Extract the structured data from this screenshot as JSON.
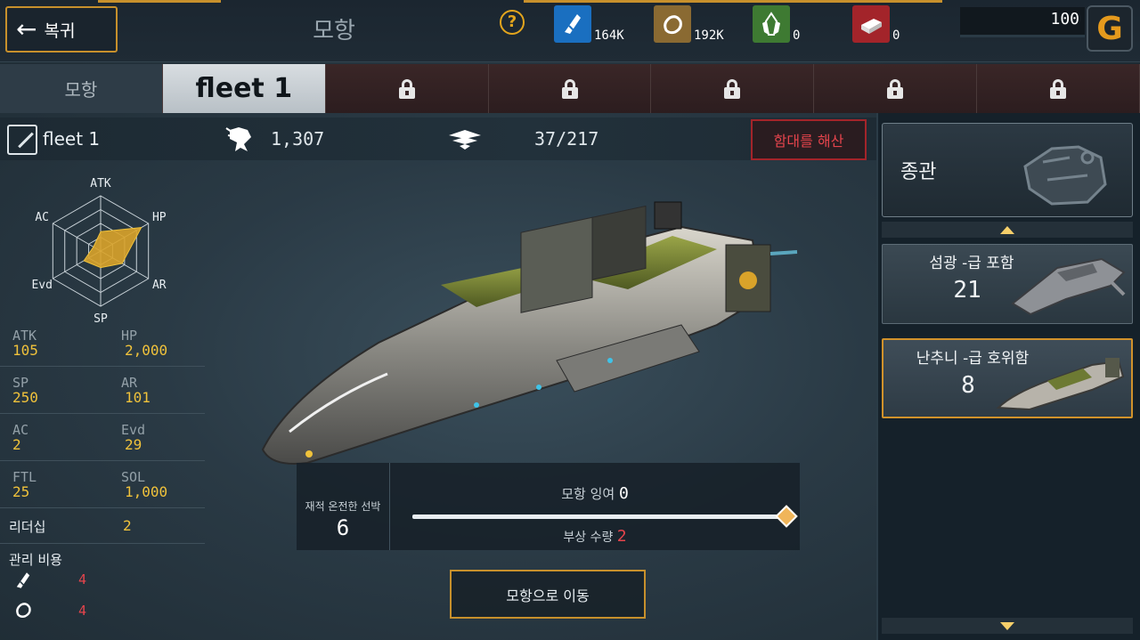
{
  "header": {
    "back_label": "복귀",
    "title": "모항",
    "help_symbol": "?",
    "resources": [
      {
        "icon": "lightning-resource-icon",
        "value": "164K",
        "color": "#1a6fc0"
      },
      {
        "icon": "ore-resource-icon",
        "value": "192K",
        "color": "#8a6a32"
      },
      {
        "icon": "crystal-resource-icon",
        "value": "0",
        "color": "#3e7a32"
      },
      {
        "icon": "alloy-resource-icon",
        "value": "0",
        "color": "#a3242a"
      }
    ],
    "gold_value": "100",
    "gold_icon": "G"
  },
  "tabs": {
    "home": "모항",
    "active": "fleet 1",
    "locked_count": 5
  },
  "fleet": {
    "name": "fleet 1",
    "power": "1,307",
    "ships": "37/217",
    "disband_label": "함대를 해산"
  },
  "radar": {
    "labels": [
      "ATK",
      "HP",
      "AR",
      "SP",
      "Evd",
      "AC"
    ],
    "levels": [
      0.35,
      0.85,
      0.45,
      0.3,
      0.35,
      0.15
    ],
    "fill_color": "#d9a32a"
  },
  "stats": [
    {
      "l1": "ATK",
      "v1": "105",
      "l2": "HP",
      "v2": "2,000"
    },
    {
      "l1": "SP",
      "v1": "250",
      "l2": "AR",
      "v2": "101"
    },
    {
      "l1": "AC",
      "v1": "2",
      "l2": "Evd",
      "v2": "29"
    },
    {
      "l1": "FTL",
      "v1": "25",
      "l2": "SOL",
      "v2": "1,000"
    }
  ],
  "leadership": {
    "label": "리더십",
    "value": "2"
  },
  "upkeep": {
    "label": "관리 비용",
    "items": [
      {
        "icon": "lightning-icon",
        "value": "4"
      },
      {
        "icon": "ore-icon",
        "value": "4"
      }
    ]
  },
  "loading": {
    "ready_label": "재적 온전한 선박",
    "ready_value": "6",
    "surplus_label": "모항 잉여",
    "surplus_value": "0",
    "damaged_label": "부상 수량",
    "damaged_value": "2",
    "slider_level": 1.0
  },
  "move_button": "모항으로 이동",
  "right_panel": {
    "flagship_label": "종관",
    "ships": [
      {
        "name": "섬광 -급 포함",
        "count": "21"
      },
      {
        "name": "난추니 -급 호위함",
        "count": "8"
      }
    ]
  }
}
